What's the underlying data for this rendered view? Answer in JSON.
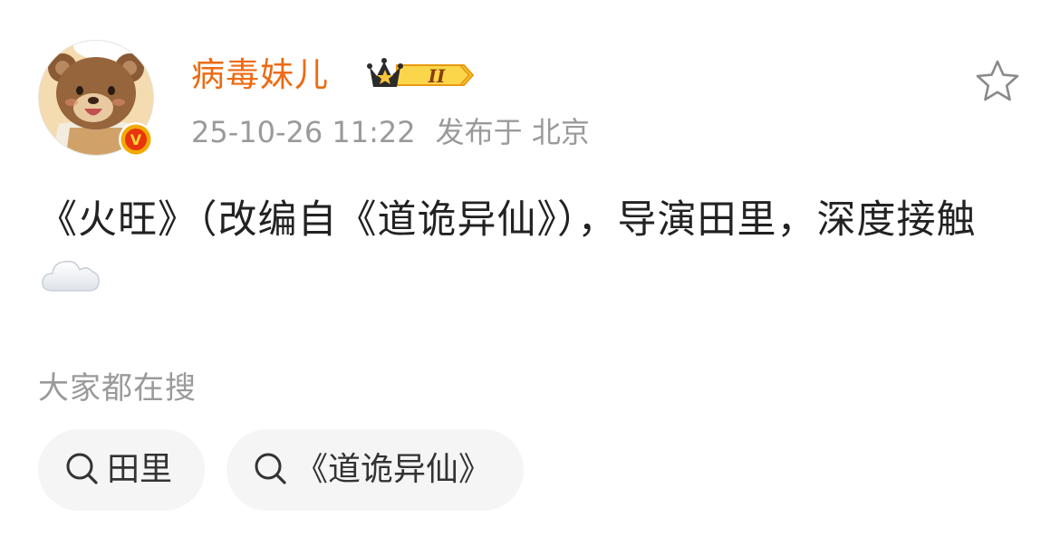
{
  "post": {
    "author": {
      "name": "病毒妹儿",
      "level_badge": "II",
      "verified_mark": "V"
    },
    "meta": {
      "time": "25-10-26 11:22",
      "location": "发布于 北京"
    },
    "content_text": "《火旺》（改编自《道诡异仙》），导演田里，深度接触",
    "content_emoji": "cloud-icon"
  },
  "related": {
    "label": "大家都在搜",
    "chips": [
      {
        "label": "田里"
      },
      {
        "label": "《道诡异仙》"
      }
    ]
  },
  "colors": {
    "username": "#ee6a12",
    "meta": "#9a9a9a",
    "body_text": "#222222",
    "chip_bg": "#f5f5f5",
    "verified_orange": "#f2a900",
    "verified_red": "#e8340f"
  },
  "icons": {
    "favorite": "star-outline-icon",
    "search": "search-icon",
    "weather": "cloud-icon",
    "level": "crown-icon"
  }
}
